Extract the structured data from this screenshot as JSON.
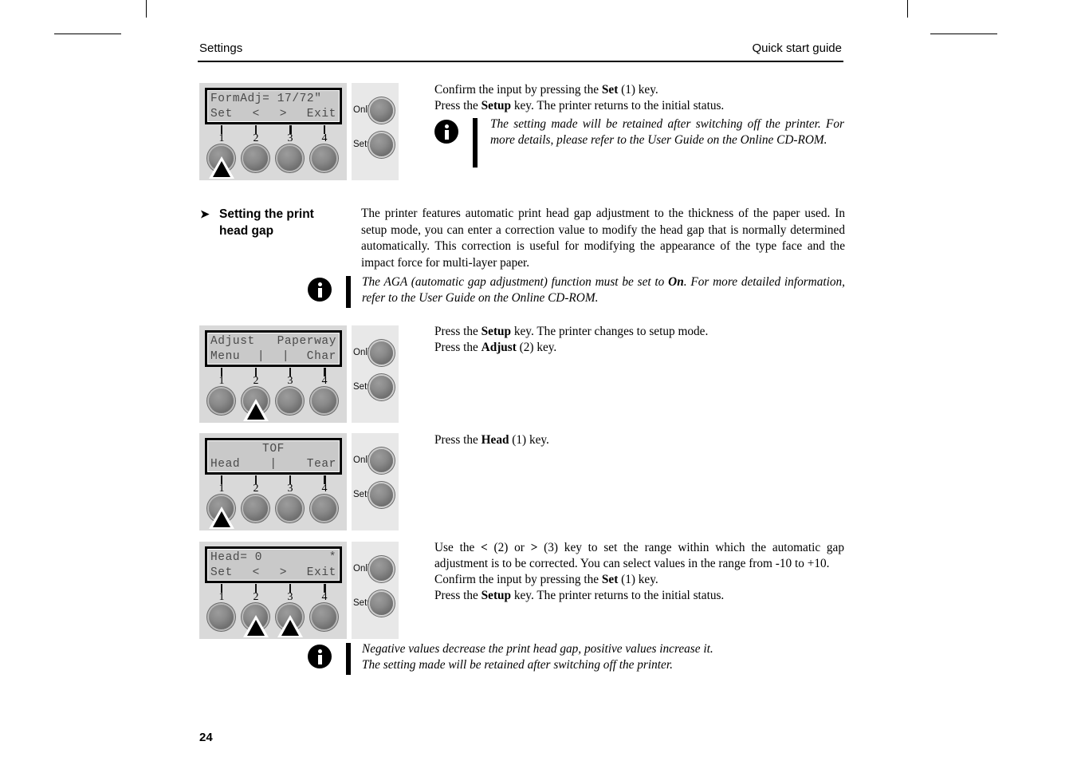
{
  "header": {
    "left": "Settings",
    "right": "Quick start guide"
  },
  "folio": "24",
  "section": {
    "arrow_glyph": "➤",
    "heading_line1": "Setting the print",
    "heading_line2": "head gap",
    "body": "The printer features automatic print head gap adjustment to the thickness of the paper used. In setup mode, you can enter a correction value to modify the head gap that is normally determined automatically. This correction is useful for modifying the appearance of the type face and the impact force for multi-layer paper."
  },
  "panels": [
    {
      "id": "panel-formadj",
      "lcd": {
        "line1_left": "FormAdj= 17/72\"",
        "line1_right": "",
        "line2_segments": [
          "Set",
          "<",
          ">",
          "Exit"
        ]
      },
      "key_numbers": [
        "1",
        "2",
        "3",
        "4"
      ],
      "active_keys": [
        1
      ],
      "side_keys": {
        "online": "Online",
        "setup": "Setup"
      }
    },
    {
      "id": "panel-adjust",
      "lcd": {
        "line1_left": "Adjust",
        "line1_right": "Paperway",
        "line2_segments": [
          "Menu",
          "|",
          "|",
          "Char"
        ]
      },
      "key_numbers": [
        "1",
        "2",
        "3",
        "4"
      ],
      "active_keys": [
        2
      ],
      "side_keys": {
        "online": "Online",
        "setup": "Setup"
      }
    },
    {
      "id": "panel-tof",
      "lcd": {
        "line1_left": "",
        "line1_center": "TOF",
        "line1_right": "",
        "line2_segments": [
          "Head",
          "",
          "|",
          "Tear"
        ]
      },
      "key_numbers": [
        "1",
        "2",
        "3",
        "4"
      ],
      "active_keys": [
        1
      ],
      "side_keys": {
        "online": "Online",
        "setup": "Setup"
      }
    },
    {
      "id": "panel-head",
      "lcd": {
        "line1_left": "Head= 0",
        "line1_right": "*",
        "line2_segments": [
          "Set",
          "<",
          ">",
          "Exit"
        ]
      },
      "key_numbers": [
        "1",
        "2",
        "3",
        "4"
      ],
      "active_keys": [
        2,
        3
      ],
      "side_keys": {
        "online": "Online",
        "setup": "Setup"
      }
    }
  ],
  "instructions": {
    "block1": {
      "line1_a": "Confirm the input by pressing the ",
      "line1_b": "Set",
      "line1_c": " (1) key.",
      "line2_a": "Press the ",
      "line2_b": "Setup",
      "line2_c": " key. The printer returns to the initial status."
    },
    "block2": {
      "line1_a": "Press the ",
      "line1_b": "Setup",
      "line1_c": " key. The printer changes to setup mode.",
      "line2_a": "Press the ",
      "line2_b": "Adjust",
      "line2_c": " (2) key."
    },
    "block3": {
      "line1_a": "Press the ",
      "line1_b": "Head",
      "line1_c": " (1) key."
    },
    "block4": {
      "p1_a": "Use the ",
      "p1_lt": "<",
      "p1_b": " (2) or ",
      "p1_gt": ">",
      "p1_c": " (3) key to set the range within which the automatic gap adjustment is to be corrected. You can select values in the range from -10 to +10.",
      "line2_a": "Confirm the input by pressing the ",
      "line2_b": "Set",
      "line2_c": " (1) key.",
      "line3_a": "Press the ",
      "line3_b": "Setup",
      "line3_c": " key. The printer returns to the initial status."
    }
  },
  "notes": {
    "note1": {
      "text_a": "The setting made will be retained after switching off the printer. For more details, please refer to the User Guide on the Online CD-ROM."
    },
    "note2": {
      "text_a": "The AGA (automatic gap adjustment) function must be set to ",
      "text_b": "On",
      "text_c": ". For more detailed information, refer to the User Guide on the Online CD-ROM."
    },
    "note3": {
      "line1": "Negative values decrease the print head gap, positive values increase it.",
      "line2": "The setting made will be retained after switching off the printer."
    }
  },
  "colors": {
    "panel_left_bg": "#d9d9d9",
    "panel_right_bg": "#e8e8e8",
    "lcd_bg": "#c9c9c9",
    "lcd_text": "#4a4a4a",
    "ink": "#000000"
  }
}
